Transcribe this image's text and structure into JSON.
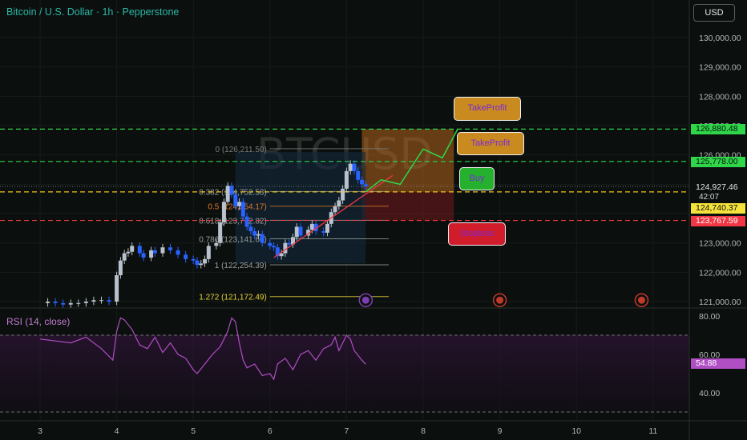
{
  "header": {
    "title": "Bitcoin / U.S. Dollar · 1h · Pepperstone",
    "currency": "USD",
    "watermark": "BTCUSD"
  },
  "price_scale": {
    "ticks": [
      "130,000.00",
      "129,000.00",
      "128,000.00",
      "127,000.00",
      "126,000.00",
      "123,000.00",
      "122,000.00",
      "121,000.00"
    ],
    "tags": {
      "tp1": "126,880.48",
      "tp2": "125,778.00",
      "last": "124,927.46",
      "countdown": "42:07",
      "entry": "124,740.37",
      "stop": "123,767.59"
    }
  },
  "time_axis": [
    "3",
    "4",
    "5",
    "6",
    "7",
    "8",
    "9",
    "10",
    "11"
  ],
  "fib_labels": {
    "level_0": "0 (126,211.50)",
    "level_0382": "0.382 (124,752.53)",
    "level_05": "0.5 (124,254.17)",
    "level_0618": "0.618 (123,772.82)",
    "level_0786": "0.786 (123,141.60)",
    "level_1": "1 (122,254.39)",
    "level_1272": "1.272 (121,172.49)"
  },
  "annotations": {
    "take_profit_1": "TakeProfit",
    "take_profit_2": "TakeProfit",
    "buy": "Buy",
    "stoploss": "Stoploss"
  },
  "rsi": {
    "title": "RSI (14, close)",
    "ticks": [
      "80.00",
      "60.00",
      "40.00"
    ],
    "value": "54.88"
  },
  "colors": {
    "background": "#0b0f0d",
    "bull": "#b9c2cc",
    "bear": "#2962ff",
    "tp_line": "#2fd64a",
    "entry_line": "#f5c518",
    "stop_line": "#f23645",
    "rsi_line": "#b04ec4"
  },
  "chart_data": [
    {
      "type": "line",
      "title": "Bitcoin / U.S. Dollar · 1h · Pepperstone",
      "x_ticks": [
        "3",
        "4",
        "5",
        "6",
        "7",
        "8",
        "9",
        "10",
        "11"
      ],
      "ylim": [
        121000,
        130600
      ],
      "price_series_approx": [
        [
          3.0,
          120950
        ],
        [
          3.1,
          121000
        ],
        [
          3.2,
          120950
        ],
        [
          3.3,
          120900
        ],
        [
          3.4,
          120950
        ],
        [
          3.5,
          120950
        ],
        [
          3.6,
          121000
        ],
        [
          3.7,
          121050
        ],
        [
          3.8,
          121050
        ],
        [
          3.9,
          121000
        ],
        [
          4.0,
          121900
        ],
        [
          4.05,
          122400
        ],
        [
          4.1,
          122650
        ],
        [
          4.15,
          122700
        ],
        [
          4.2,
          122900
        ],
        [
          4.3,
          122650
        ],
        [
          4.35,
          122500
        ],
        [
          4.45,
          122750
        ],
        [
          4.5,
          122650
        ],
        [
          4.6,
          122850
        ],
        [
          4.7,
          122750
        ],
        [
          4.8,
          122600
        ],
        [
          4.9,
          122450
        ],
        [
          5.0,
          122400
        ],
        [
          5.05,
          122250
        ],
        [
          5.1,
          122300
        ],
        [
          5.15,
          122450
        ],
        [
          5.2,
          122900
        ],
        [
          5.3,
          123000
        ],
        [
          5.35,
          123700
        ],
        [
          5.4,
          124400
        ],
        [
          5.45,
          124950
        ],
        [
          5.5,
          124650
        ],
        [
          5.55,
          124250
        ],
        [
          5.6,
          124400
        ],
        [
          5.65,
          123900
        ],
        [
          5.7,
          123550
        ],
        [
          5.75,
          123400
        ],
        [
          5.8,
          123250
        ],
        [
          5.85,
          123300
        ],
        [
          5.9,
          123000
        ],
        [
          6.0,
          122900
        ],
        [
          6.05,
          122850
        ],
        [
          6.1,
          122550
        ],
        [
          6.15,
          122650
        ],
        [
          6.2,
          123000
        ],
        [
          6.25,
          122950
        ],
        [
          6.3,
          123200
        ],
        [
          6.35,
          123550
        ],
        [
          6.4,
          123250
        ],
        [
          6.5,
          123450
        ],
        [
          6.55,
          123650
        ],
        [
          6.6,
          123400
        ],
        [
          6.7,
          123350
        ],
        [
          6.75,
          123650
        ],
        [
          6.8,
          124050
        ],
        [
          6.85,
          124250
        ],
        [
          6.9,
          124450
        ],
        [
          6.95,
          124850
        ],
        [
          7.0,
          125450
        ],
        [
          7.05,
          125700
        ],
        [
          7.1,
          125450
        ],
        [
          7.15,
          125150
        ],
        [
          7.2,
          125000
        ],
        [
          7.25,
          124927
        ]
      ],
      "fib_levels": [
        {
          "ratio": "0",
          "price": 126211.5
        },
        {
          "ratio": "0.382",
          "price": 124752.53
        },
        {
          "ratio": "0.5",
          "price": 124254.17
        },
        {
          "ratio": "0.618",
          "price": 123772.82
        },
        {
          "ratio": "0.786",
          "price": 123141.6
        },
        {
          "ratio": "1",
          "price": 122254.39
        },
        {
          "ratio": "1.272",
          "price": 121172.49
        }
      ],
      "horizontal_lines": [
        {
          "name": "TakeProfit",
          "price": 126880.48,
          "color": "#2fd64a"
        },
        {
          "name": "TakeProfit",
          "price": 125778.0,
          "color": "#2fd64a"
        },
        {
          "name": "Buy",
          "price": 124740.37,
          "color": "#f5c518"
        },
        {
          "name": "Stoploss",
          "price": 123767.59,
          "color": "#f23645"
        }
      ],
      "last_price": 124927.46
    },
    {
      "type": "line",
      "title": "RSI (14, close)",
      "ylim": [
        30,
        84
      ],
      "ticks": [
        80,
        60,
        40
      ],
      "bands": [
        70,
        30
      ],
      "last_value": 54.88,
      "series_approx": [
        [
          3.0,
          68
        ],
        [
          3.2,
          67
        ],
        [
          3.4,
          66
        ],
        [
          3.6,
          69
        ],
        [
          3.8,
          63
        ],
        [
          3.95,
          57
        ],
        [
          4.0,
          72
        ],
        [
          4.05,
          79
        ],
        [
          4.1,
          78
        ],
        [
          4.2,
          73
        ],
        [
          4.3,
          65
        ],
        [
          4.4,
          63
        ],
        [
          4.5,
          69
        ],
        [
          4.6,
          61
        ],
        [
          4.7,
          66
        ],
        [
          4.8,
          60
        ],
        [
          4.9,
          58
        ],
        [
          5.0,
          52
        ],
        [
          5.05,
          50
        ],
        [
          5.15,
          55
        ],
        [
          5.25,
          60
        ],
        [
          5.35,
          64
        ],
        [
          5.45,
          72
        ],
        [
          5.5,
          79
        ],
        [
          5.55,
          77
        ],
        [
          5.6,
          66
        ],
        [
          5.65,
          57
        ],
        [
          5.7,
          53
        ],
        [
          5.8,
          55
        ],
        [
          5.9,
          49
        ],
        [
          6.0,
          50
        ],
        [
          6.05,
          47
        ],
        [
          6.1,
          55
        ],
        [
          6.2,
          58
        ],
        [
          6.3,
          52
        ],
        [
          6.4,
          60
        ],
        [
          6.5,
          62
        ],
        [
          6.6,
          57
        ],
        [
          6.7,
          63
        ],
        [
          6.8,
          65
        ],
        [
          6.85,
          69
        ],
        [
          6.9,
          62
        ],
        [
          6.95,
          66
        ],
        [
          7.0,
          70
        ],
        [
          7.05,
          68
        ],
        [
          7.1,
          62
        ],
        [
          7.2,
          57
        ],
        [
          7.25,
          54.88
        ]
      ]
    }
  ]
}
